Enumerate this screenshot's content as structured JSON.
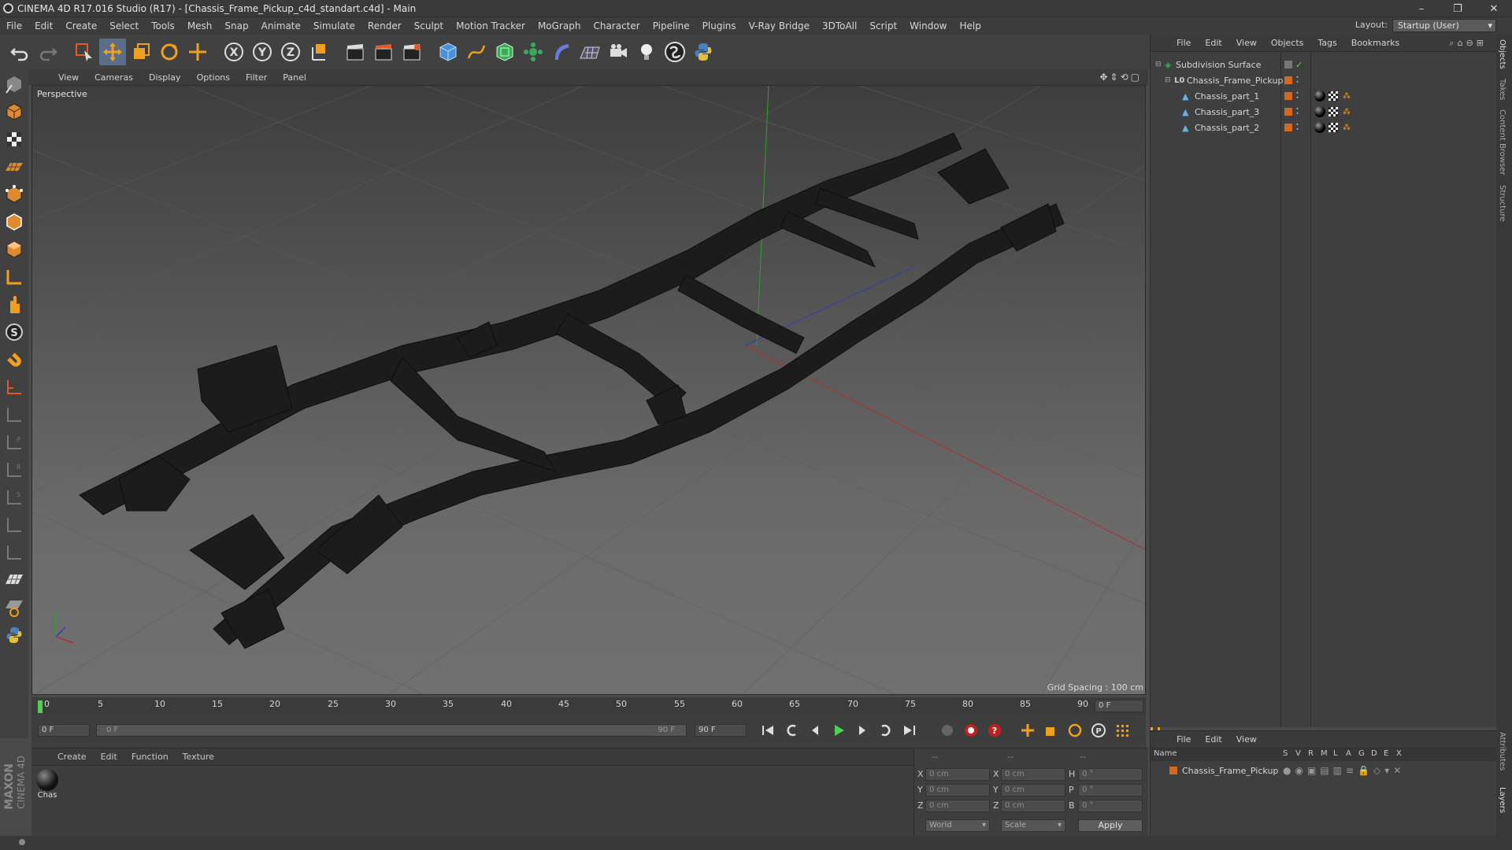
{
  "window": {
    "title": "CINEMA 4D R17.016 Studio (R17) - [Chassis_Frame_Pickup_c4d_standart.c4d] - Main"
  },
  "menu": [
    "File",
    "Edit",
    "Create",
    "Select",
    "Tools",
    "Mesh",
    "Snap",
    "Animate",
    "Simulate",
    "Render",
    "Sculpt",
    "Motion Tracker",
    "MoGraph",
    "Character",
    "Pipeline",
    "Plugins",
    "V-Ray Bridge",
    "3DToAll",
    "Script",
    "Window",
    "Help"
  ],
  "layout": {
    "label": "Layout:",
    "value": "Startup (User)"
  },
  "viewport": {
    "menu": [
      "View",
      "Cameras",
      "Display",
      "Options",
      "Filter",
      "Panel"
    ],
    "label": "Perspective",
    "grid_spacing": "Grid Spacing : 100 cm"
  },
  "timeline": {
    "ticks": [
      "0",
      "5",
      "10",
      "15",
      "20",
      "25",
      "30",
      "35",
      "40",
      "45",
      "50",
      "55",
      "60",
      "65",
      "70",
      "75",
      "80",
      "85",
      "90"
    ],
    "current_frame": "0 F",
    "start_field": "0 F",
    "range_start": "0 F",
    "range_end": "90 F",
    "end_field": "90 F"
  },
  "material_panel": {
    "menu": [
      "Create",
      "Edit",
      "Function",
      "Texture"
    ],
    "materials": [
      {
        "name": "Chas"
      }
    ]
  },
  "coords": {
    "header_dash": [
      "--",
      "--",
      "--"
    ],
    "rows": [
      {
        "a": "X",
        "av": "0 cm",
        "b": "X",
        "bv": "0 cm",
        "c": "H",
        "cv": "0 °"
      },
      {
        "a": "Y",
        "av": "0 cm",
        "b": "Y",
        "bv": "0 cm",
        "c": "P",
        "cv": "0 °"
      },
      {
        "a": "Z",
        "av": "0 cm",
        "b": "Z",
        "bv": "0 cm",
        "c": "B",
        "cv": "0 °"
      }
    ],
    "space": "World",
    "mode": "Scale",
    "apply": "Apply"
  },
  "object_manager": {
    "menu": [
      "File",
      "Edit",
      "View",
      "Objects",
      "Tags",
      "Bookmarks"
    ],
    "objects": [
      {
        "name": "Subdivision Surface",
        "level": 0
      },
      {
        "name": "Chassis_Frame_Pickup",
        "level": 1
      },
      {
        "name": "Chassis_part_1",
        "level": 2
      },
      {
        "name": "Chassis_part_3",
        "level": 2
      },
      {
        "name": "Chassis_part_2",
        "level": 2
      }
    ]
  },
  "layer_manager": {
    "menu": [
      "File",
      "Edit",
      "View"
    ],
    "columns": [
      "Name",
      "S",
      "V",
      "R",
      "M",
      "L",
      "A",
      "G",
      "D",
      "E",
      "X"
    ],
    "layers": [
      {
        "name": "Chassis_Frame_Pickup"
      }
    ]
  },
  "side_tabs": [
    "Objects",
    "Takes",
    "Content Browser",
    "Structure"
  ],
  "side_tabs_bottom": [
    "Attributes",
    "Layers"
  ],
  "brand": {
    "line1": "MAXON",
    "line2": "CINEMA 4D"
  },
  "colors": {
    "accent": "#5a6e8a",
    "tag_orange": "#d2691e",
    "axis_x": "#b03030",
    "axis_y": "#30a030",
    "axis_z": "#3040b0"
  }
}
